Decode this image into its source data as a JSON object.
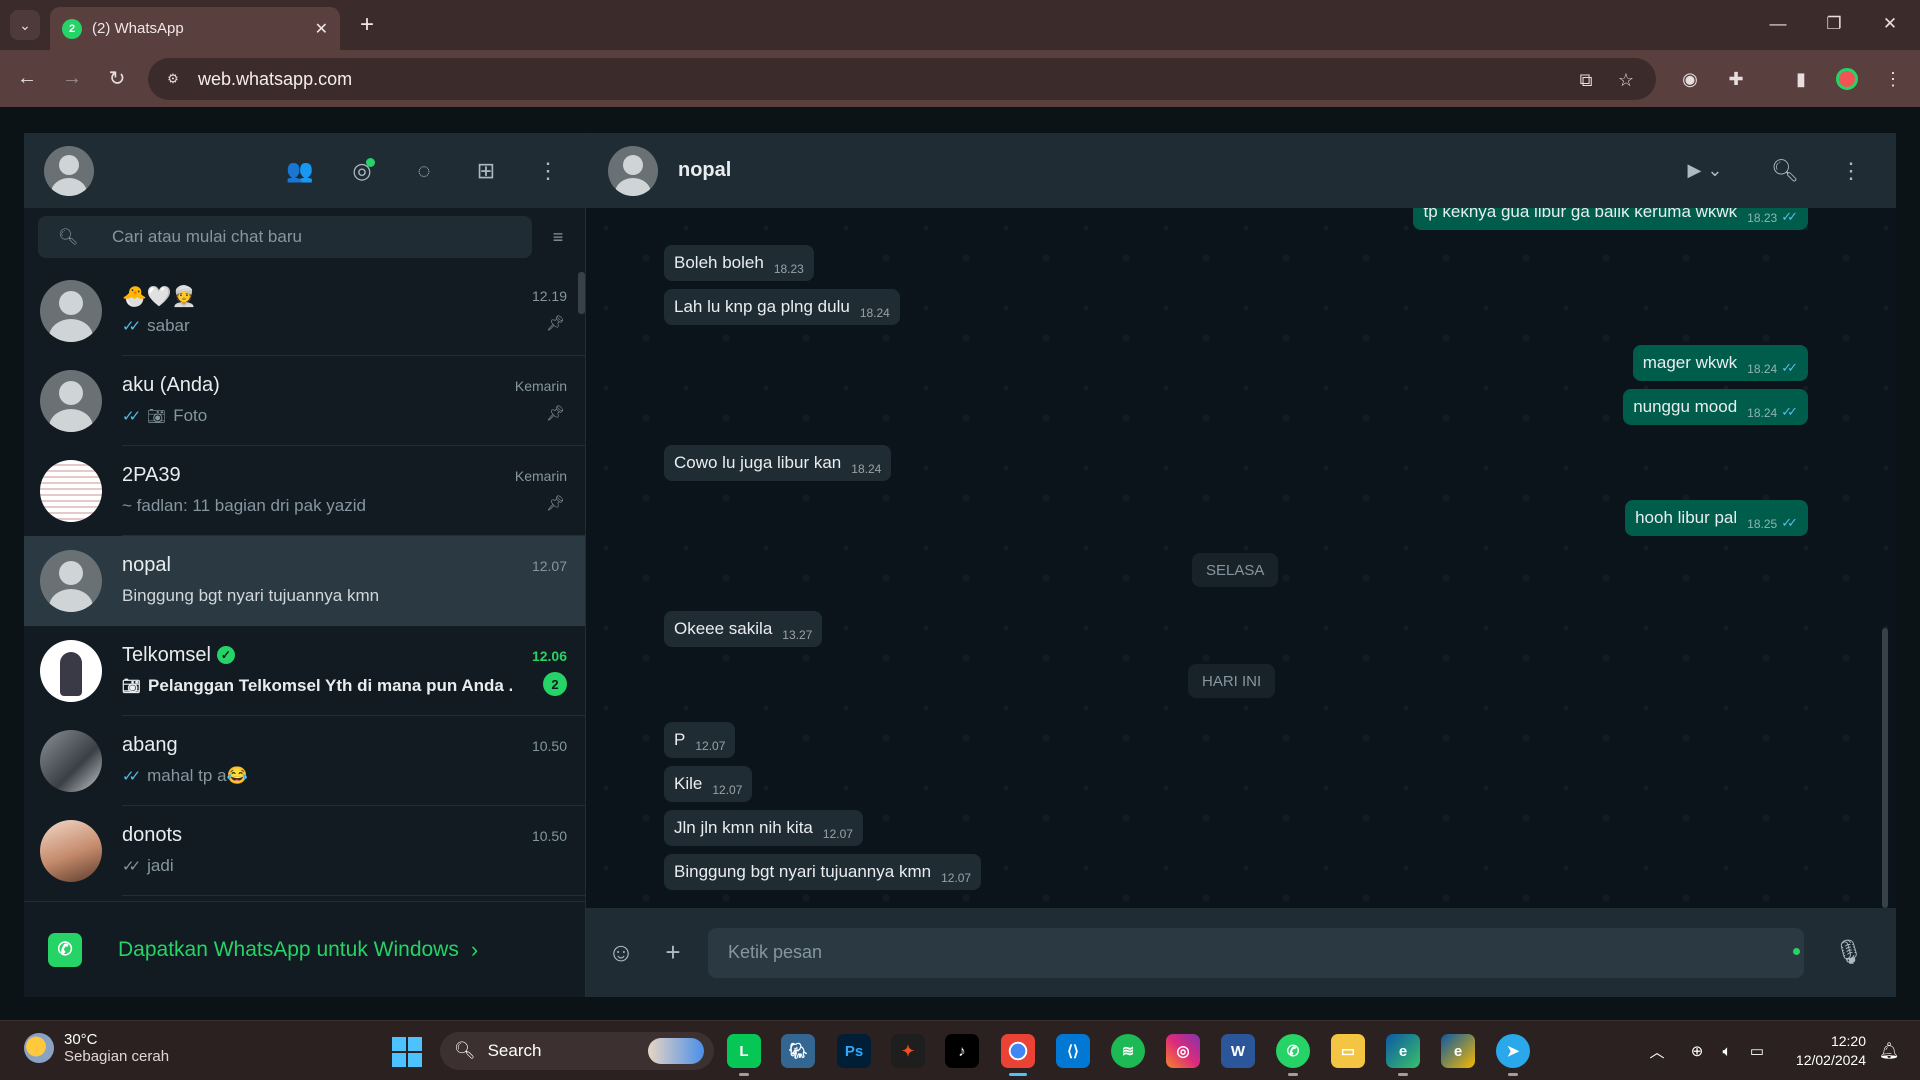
{
  "browser": {
    "tab_title": "(2) WhatsApp",
    "tab_badge": "2",
    "url": "web.whatsapp.com"
  },
  "sidebar": {
    "search_placeholder": "Cari atau mulai chat baru",
    "chats": [
      {
        "name": "🐣🤍👳",
        "time": "12.19",
        "preview": "sabar",
        "ticks": "read",
        "pinned": true
      },
      {
        "name": "aku (Anda)",
        "time": "Kemarin",
        "preview": "Foto",
        "ticks": "read",
        "pinned": true,
        "media": "camera"
      },
      {
        "name": "2PA39",
        "time": "Kemarin",
        "preview": "~ fadlan: 11 bagian dri pak yazid",
        "pinned": true
      },
      {
        "name": "nopal",
        "time": "12.07",
        "preview": "Binggung bgt nyari tujuannya kmn",
        "active": true
      },
      {
        "name": "Telkomsel",
        "time": "12.06",
        "preview": "Pelanggan Telkomsel Yth di mana pun Anda ...",
        "unread": "2",
        "verified": true,
        "media": "camera"
      },
      {
        "name": "abang",
        "time": "10.50",
        "preview": "mahal tp a😂",
        "ticks": "read"
      },
      {
        "name": "donots",
        "time": "10.50",
        "preview": "jadi",
        "ticks": "delivered"
      }
    ],
    "get_app_text": "Dapatkan WhatsApp untuk Windows"
  },
  "conversation": {
    "contact_name": "nopal",
    "messages": [
      {
        "dir": "out",
        "text": "tp kekhya gua libur ga balik kerumа wkwk",
        "time": "18.23"
      },
      {
        "dir": "in",
        "text": "Boleh boleh",
        "time": "18.23"
      },
      {
        "dir": "in",
        "text": "Lah lu knp ga plng dulu",
        "time": "18.24"
      },
      {
        "dir": "out",
        "text": "mager wkwk",
        "time": "18.24"
      },
      {
        "dir": "out",
        "text": "nunggu mood",
        "time": "18.24"
      },
      {
        "dir": "in",
        "text": "Cowo lu juga libur kan",
        "time": "18.24"
      },
      {
        "dir": "out",
        "text": "hooh libur pal",
        "time": "18.25"
      },
      {
        "dir": "in",
        "text": "Okeee sakila",
        "time": "13.27"
      },
      {
        "dir": "in",
        "text": "P",
        "time": "12.07"
      },
      {
        "dir": "in",
        "text": "Kile",
        "time": "12.07"
      },
      {
        "dir": "in",
        "text": "Jln jln kmn nih kita",
        "time": "12.07"
      },
      {
        "dir": "in",
        "text": "Binggung bgt nyari tujuannya kmn",
        "time": "12.07"
      }
    ],
    "date_separators": [
      "SELASA",
      "HARI INI"
    ],
    "input_placeholder": "Ketik pesan"
  },
  "taskbar": {
    "weather_temp": "30°C",
    "weather_desc": "Sebagian cerah",
    "search_label": "Search",
    "time": "12:20",
    "date": "12/02/2024"
  },
  "icons": {
    "ticks_read_color": "#53bdeb",
    "accent": "#25d366",
    "outgoing_bubble": "#005c4b",
    "incoming_bubble": "#202c33"
  }
}
